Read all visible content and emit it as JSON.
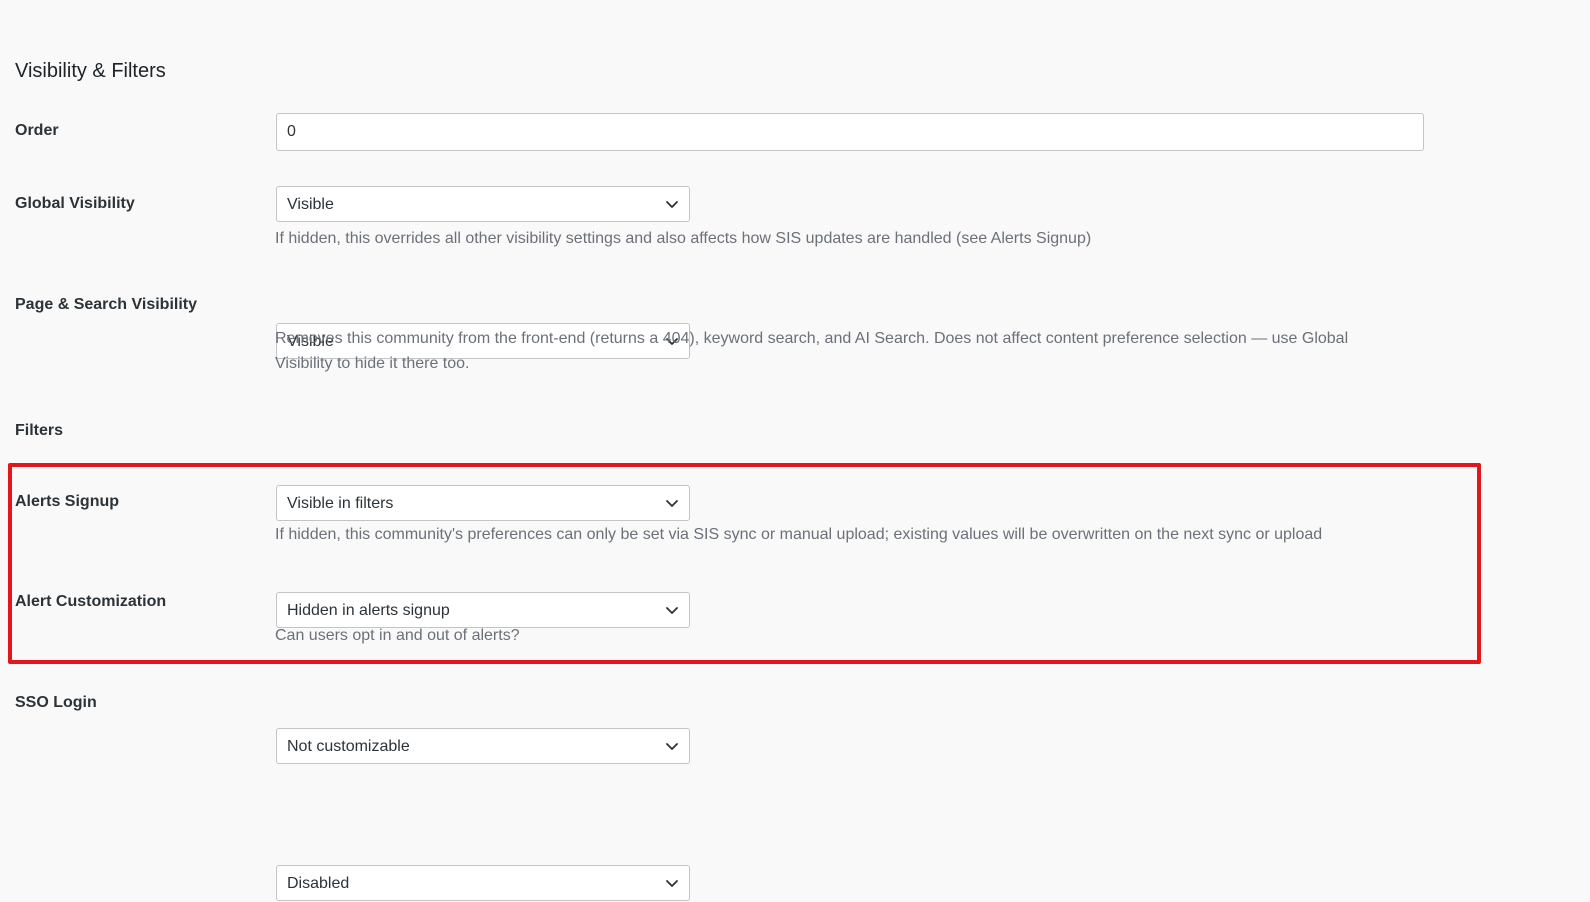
{
  "section": {
    "title": "Visibility & Filters"
  },
  "fields": {
    "order": {
      "label": "Order",
      "value": "0"
    },
    "global_visibility": {
      "label": "Global Visibility",
      "value": "Visible",
      "description": "If hidden, this overrides all other visibility settings and also affects how SIS updates are handled (see Alerts Signup)"
    },
    "page_search_visibility": {
      "label": "Page & Search Visibility",
      "value": "Visible",
      "description": "Removes this community from the front-end (returns a 404), keyword search, and AI Search. Does not affect content preference selection — use Global Visibility to hide it there too."
    },
    "filters": {
      "label": "Filters",
      "value": "Visible in filters"
    },
    "alerts_signup": {
      "label": "Alerts Signup",
      "value": "Hidden in alerts signup",
      "description": "If hidden, this community's preferences can only be set via SIS sync or manual upload; existing values will be overwritten on the next sync or upload"
    },
    "alert_customization": {
      "label": "Alert Customization",
      "value": "Not customizable",
      "description": "Can users opt in and out of alerts?"
    },
    "sso_login": {
      "label": "SSO Login",
      "value": "Disabled"
    }
  },
  "icons": {
    "select_arrow": "chevron-down-icon"
  },
  "colors": {
    "highlight_border": "#e3161b",
    "background": "#f9f9f9",
    "description_text": "#6b7079"
  }
}
